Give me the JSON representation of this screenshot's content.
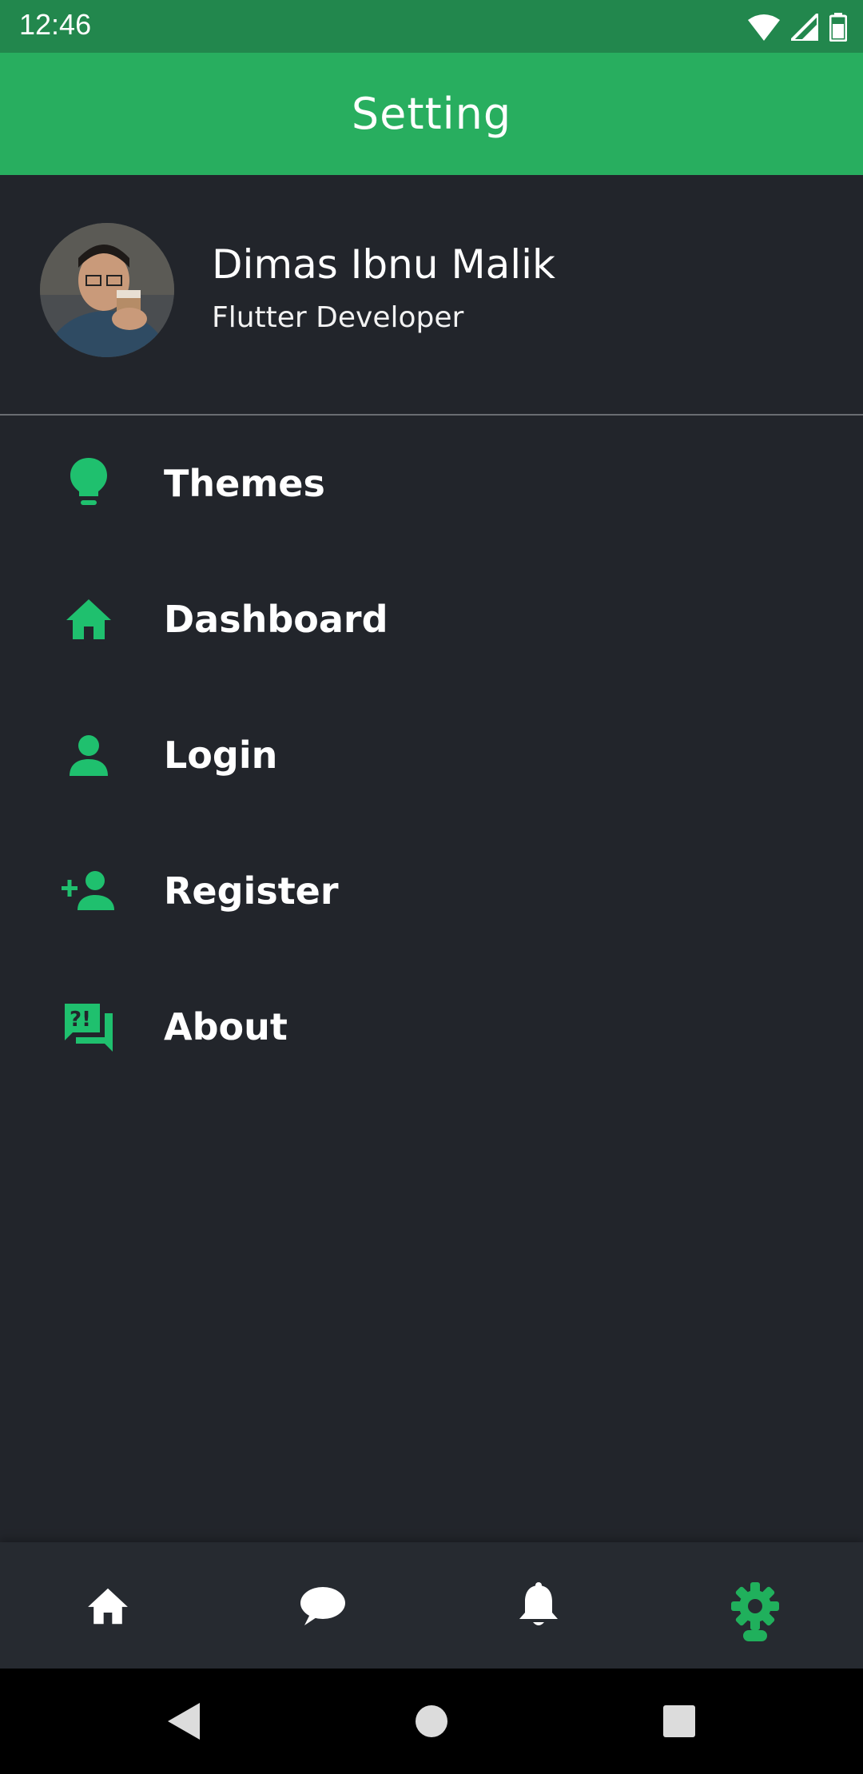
{
  "status_bar": {
    "time": "12:46"
  },
  "app_bar": {
    "title": "Setting"
  },
  "profile": {
    "name": "Dimas Ibnu Malik",
    "role": "Flutter Developer"
  },
  "menu": [
    {
      "label": "Themes",
      "icon": "lightbulb-icon"
    },
    {
      "label": "Dashboard",
      "icon": "home-icon"
    },
    {
      "label": "Login",
      "icon": "person-icon"
    },
    {
      "label": "Register",
      "icon": "person-add-icon"
    },
    {
      "label": "About",
      "icon": "about-chat-icon"
    }
  ],
  "bottom_nav": [
    {
      "icon": "home-icon",
      "active": false
    },
    {
      "icon": "chat-icon",
      "active": false
    },
    {
      "icon": "bell-icon",
      "active": false
    },
    {
      "icon": "settings-icon",
      "active": true
    }
  ],
  "colors": {
    "accent": "#20b05c",
    "app_bar": "#28ae5f",
    "status_bar": "#22874d",
    "background": "#22252b",
    "icon_green": "#1fc06e"
  }
}
